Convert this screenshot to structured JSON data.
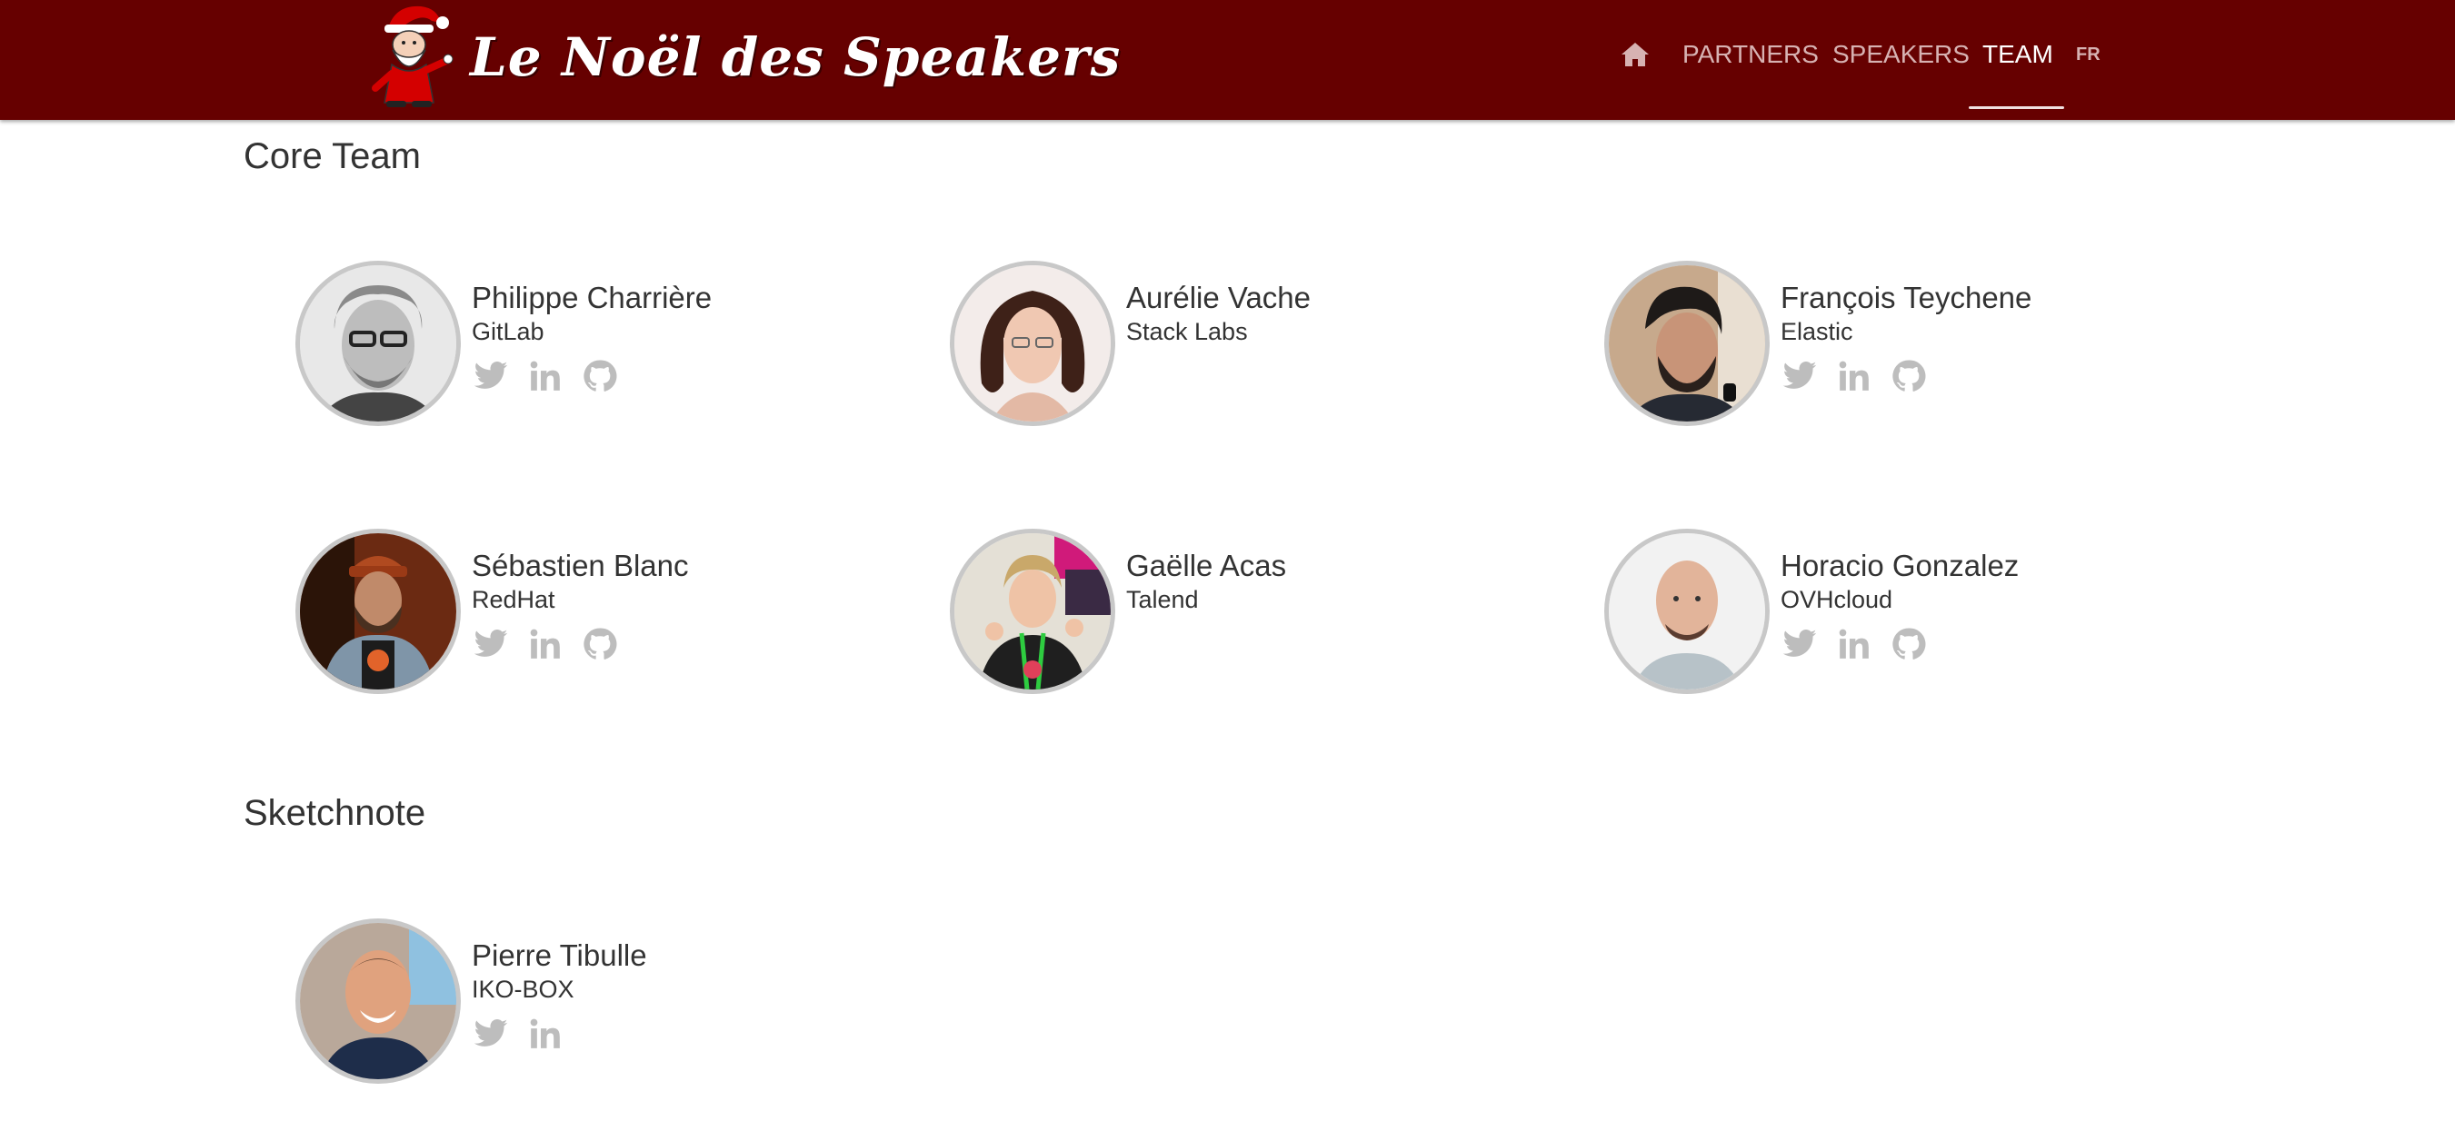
{
  "brand": {
    "title": "Le Noël des Speakers"
  },
  "nav": {
    "home_icon": "home-icon",
    "items": [
      "PARTNERS",
      "SPEAKERS",
      "TEAM"
    ],
    "active": "TEAM",
    "language": "FR"
  },
  "colors": {
    "header_bg": "#660000",
    "nav_text": "#d7b2b2",
    "active_text": "#ffffff",
    "social_icon": "#bdbdbd",
    "avatar_border": "#c8c8c8"
  },
  "sections": [
    {
      "title": "Core Team",
      "members": [
        {
          "name": "Philippe Charrière",
          "company": "GitLab",
          "socials": [
            "twitter-icon",
            "linkedin-icon",
            "github-icon"
          ]
        },
        {
          "name": "Aurélie Vache",
          "company": "Stack Labs",
          "socials": []
        },
        {
          "name": "François Teychene",
          "company": "Elastic",
          "socials": [
            "twitter-icon",
            "linkedin-icon",
            "github-icon"
          ]
        },
        {
          "name": "Sébastien Blanc",
          "company": "RedHat",
          "socials": [
            "twitter-icon",
            "linkedin-icon",
            "github-icon"
          ]
        },
        {
          "name": "Gaëlle Acas",
          "company": "Talend",
          "socials": []
        },
        {
          "name": "Horacio Gonzalez",
          "company": "OVHcloud",
          "socials": [
            "twitter-icon",
            "linkedin-icon",
            "github-icon"
          ]
        }
      ]
    },
    {
      "title": "Sketchnote",
      "members": [
        {
          "name": "Pierre Tibulle",
          "company": "IKO-BOX",
          "socials": [
            "twitter-icon",
            "linkedin-icon"
          ]
        }
      ]
    }
  ]
}
